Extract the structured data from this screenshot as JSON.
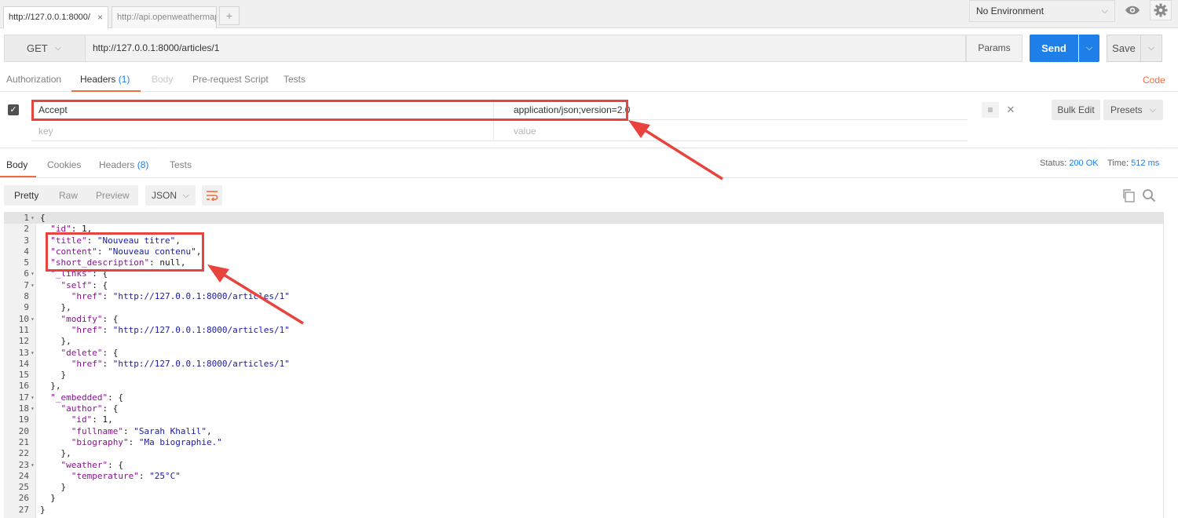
{
  "tabs": [
    {
      "label": "http://127.0.0.1:8000/",
      "active": true
    },
    {
      "label": "http://api.openweathermap",
      "active": false
    }
  ],
  "tab_close": "×",
  "tab_add": "+",
  "environment": {
    "selected": "No Environment"
  },
  "request": {
    "method": "GET",
    "url": "http://127.0.0.1:8000/articles/1",
    "params_label": "Params",
    "send_label": "Send",
    "save_label": "Save"
  },
  "request_tabs": [
    {
      "label": "Authorization"
    },
    {
      "label": "Headers",
      "count": "(1)",
      "active": true
    },
    {
      "label": "Body",
      "disabled": true
    },
    {
      "label": "Pre-request Script"
    },
    {
      "label": "Tests"
    }
  ],
  "code_link": "Code",
  "headers": {
    "key": "Accept",
    "value": "application/json;version=2.0",
    "key_placeholder": "key",
    "value_placeholder": "value",
    "bulk_edit_label": "Bulk Edit",
    "presets_label": "Presets"
  },
  "response_tabs": [
    {
      "label": "Body",
      "active": true
    },
    {
      "label": "Cookies"
    },
    {
      "label": "Headers",
      "count": "(8)"
    },
    {
      "label": "Tests"
    }
  ],
  "status": {
    "label": "Status:",
    "value": "200 OK"
  },
  "time": {
    "label": "Time:",
    "value": "512 ms"
  },
  "response_views": [
    "Pretty",
    "Raw",
    "Preview"
  ],
  "format": "JSON",
  "colors": {
    "accent": "#f26b3a",
    "primary": "#1e7fe8",
    "annotation": "#e8433d"
  },
  "code_lines": [
    {
      "n": "1",
      "fold": true,
      "t": "{"
    },
    {
      "n": "2",
      "t": "  \"id\": 1,"
    },
    {
      "n": "3",
      "t": "  \"title\": \"Nouveau titre\","
    },
    {
      "n": "4",
      "t": "  \"content\": \"Nouveau contenu\","
    },
    {
      "n": "5",
      "t": "  \"short_description\": null,"
    },
    {
      "n": "6",
      "fold": true,
      "t": "  \"_links\": {"
    },
    {
      "n": "7",
      "fold": true,
      "t": "    \"self\": {"
    },
    {
      "n": "8",
      "t": "      \"href\": \"http://127.0.0.1:8000/articles/1\""
    },
    {
      "n": "9",
      "t": "    },"
    },
    {
      "n": "10",
      "fold": true,
      "t": "    \"modify\": {"
    },
    {
      "n": "11",
      "t": "      \"href\": \"http://127.0.0.1:8000/articles/1\""
    },
    {
      "n": "12",
      "t": "    },"
    },
    {
      "n": "13",
      "fold": true,
      "t": "    \"delete\": {"
    },
    {
      "n": "14",
      "t": "      \"href\": \"http://127.0.0.1:8000/articles/1\""
    },
    {
      "n": "15",
      "t": "    }"
    },
    {
      "n": "16",
      "t": "  },"
    },
    {
      "n": "17",
      "fold": true,
      "t": "  \"_embedded\": {"
    },
    {
      "n": "18",
      "fold": true,
      "t": "    \"author\": {"
    },
    {
      "n": "19",
      "t": "      \"id\": 1,"
    },
    {
      "n": "20",
      "t": "      \"fullname\": \"Sarah Khalil\","
    },
    {
      "n": "21",
      "t": "      \"biography\": \"Ma biographie.\""
    },
    {
      "n": "22",
      "t": "    },"
    },
    {
      "n": "23",
      "fold": true,
      "t": "    \"weather\": {"
    },
    {
      "n": "24",
      "t": "      \"temperature\": \"25°C\""
    },
    {
      "n": "25",
      "t": "    }"
    },
    {
      "n": "26",
      "t": "  }"
    },
    {
      "n": "27",
      "t": "}"
    }
  ]
}
